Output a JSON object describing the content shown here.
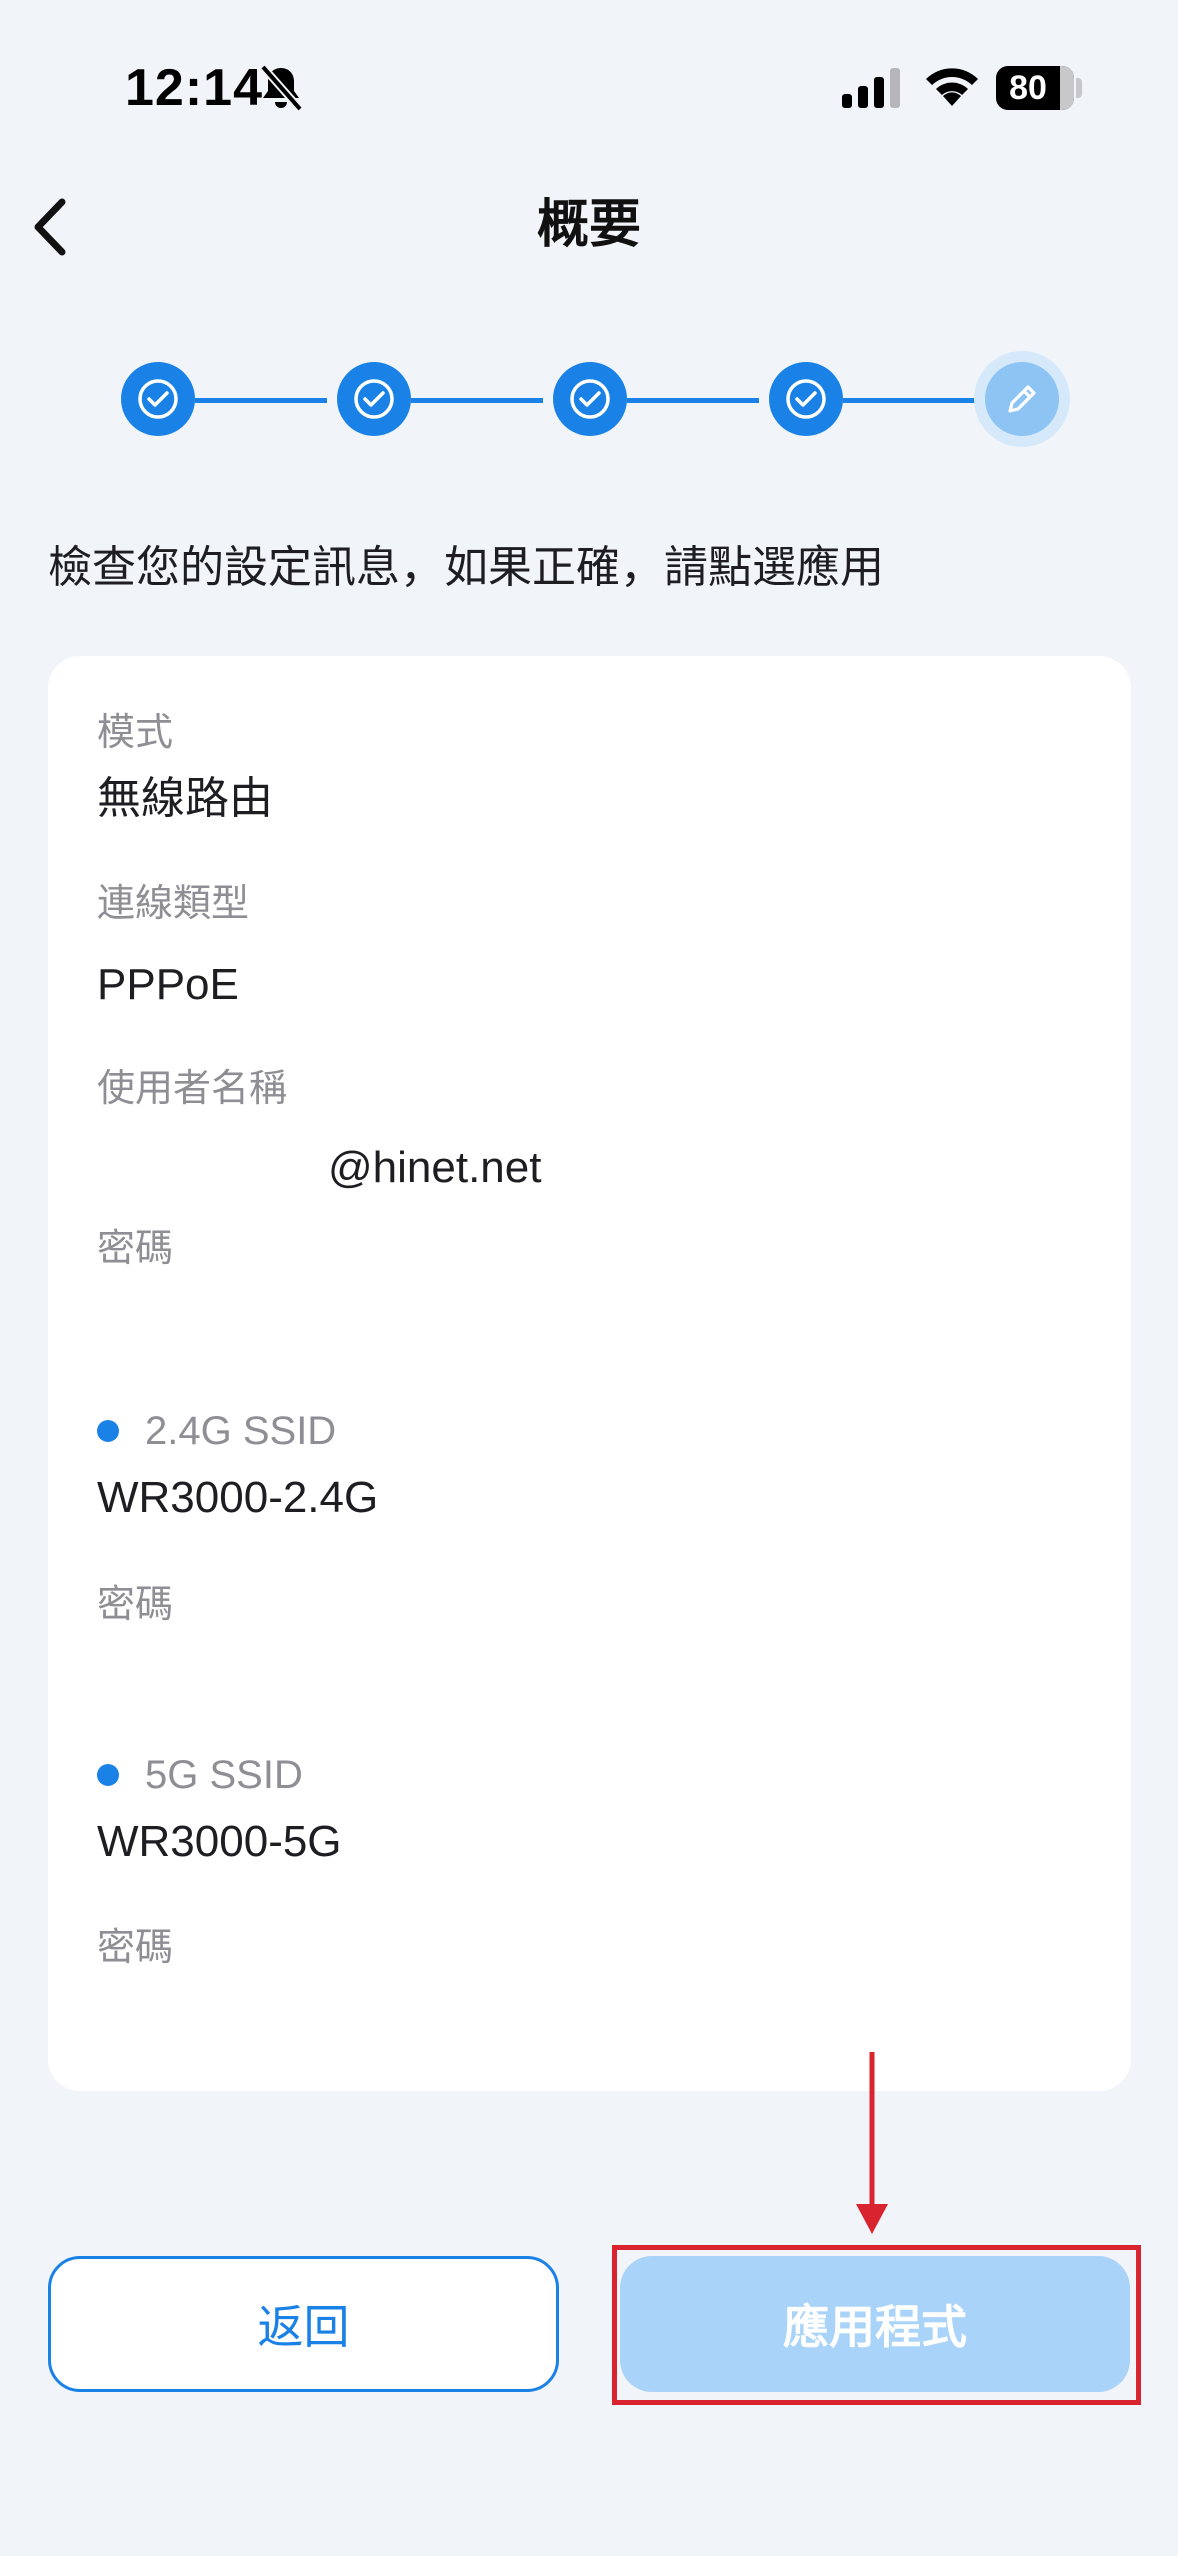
{
  "status_bar": {
    "time": "12:14",
    "battery_level": 80,
    "battery_text": "80",
    "icons": [
      "bell-slash-icon",
      "cellular-signal-icon",
      "wifi-icon",
      "battery-icon"
    ]
  },
  "nav": {
    "title": "概要",
    "back_icon": "chevron-left-icon"
  },
  "stepper": {
    "total_steps": 5,
    "completed_steps": 4,
    "current_step_icon": "pencil-icon",
    "completed_icon": "check-circle-icon"
  },
  "instruction": "檢查您的設定訊息，如果正確，請點選應用",
  "summary": {
    "mode": {
      "label": "模式",
      "value": "無線路由"
    },
    "connection_type": {
      "label": "連線類型",
      "value": "PPPoE"
    },
    "username": {
      "label": "使用者名稱",
      "value": "@hinet.net"
    },
    "password": {
      "label": "密碼",
      "value": ""
    },
    "ssid_24": {
      "label": "2.4G SSID",
      "value": "WR3000-2.4G",
      "password_label": "密碼",
      "password_value": ""
    },
    "ssid_5": {
      "label": "5G SSID",
      "value": "WR3000-5G",
      "password_label": "密碼",
      "password_value": ""
    }
  },
  "buttons": {
    "back_label": "返回",
    "apply_label": "應用程式"
  },
  "colors": {
    "accent": "#1a82e6",
    "accent_light": "#a9d3f8",
    "background": "#f1f4f8",
    "annotation": "#d9232e"
  }
}
